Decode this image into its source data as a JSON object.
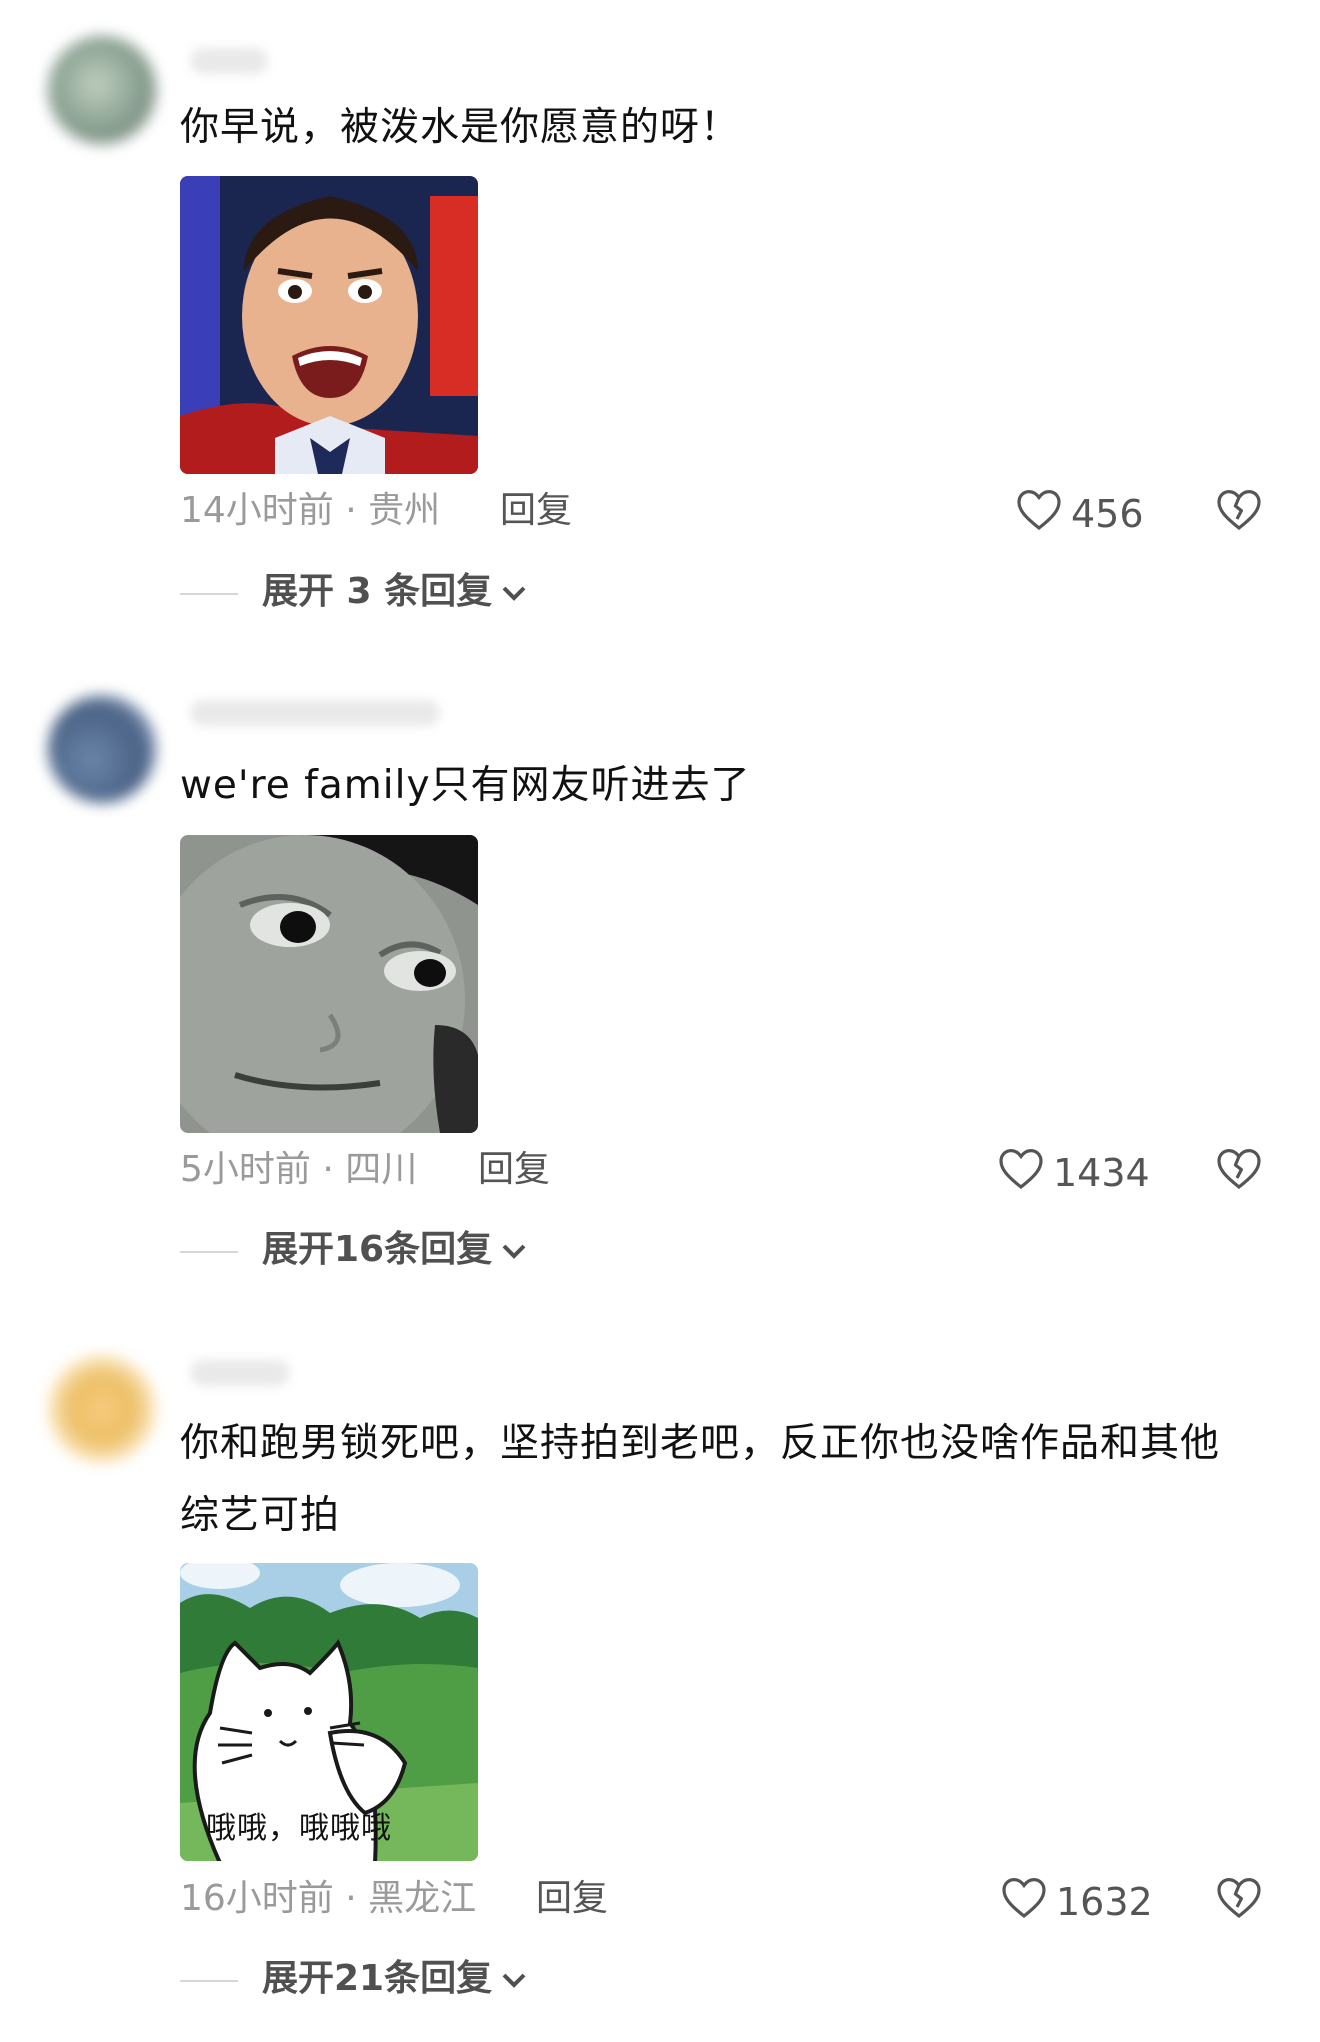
{
  "comments": [
    {
      "text": "你早说，被泼水是你愿意的呀！",
      "meta": "14小时前 · 贵州",
      "reply_label": "回复",
      "likes": "456",
      "expand_label": "展开 3 条回复"
    },
    {
      "text": "we're family只有网友听进去了",
      "meta": "5小时前 · 四川",
      "reply_label": "回复",
      "likes": "1434",
      "expand_label": "展开16条回复"
    },
    {
      "text": "你和跑男锁死吧，坚持拍到老吧，反正你也没啥作品和其他综艺可拍",
      "meta": "16小时前 · 黑龙江",
      "reply_label": "回复",
      "likes": "1632",
      "expand_label": "展开21条回复",
      "sticker_caption": "哦哦，哦哦哦"
    }
  ],
  "icons": {
    "like": "heart-outline-icon",
    "dislike": "broken-heart-icon",
    "expand": "chevron-down-icon"
  },
  "colors": {
    "text": "#111111",
    "meta": "#9a9a9a",
    "action": "#555555"
  }
}
